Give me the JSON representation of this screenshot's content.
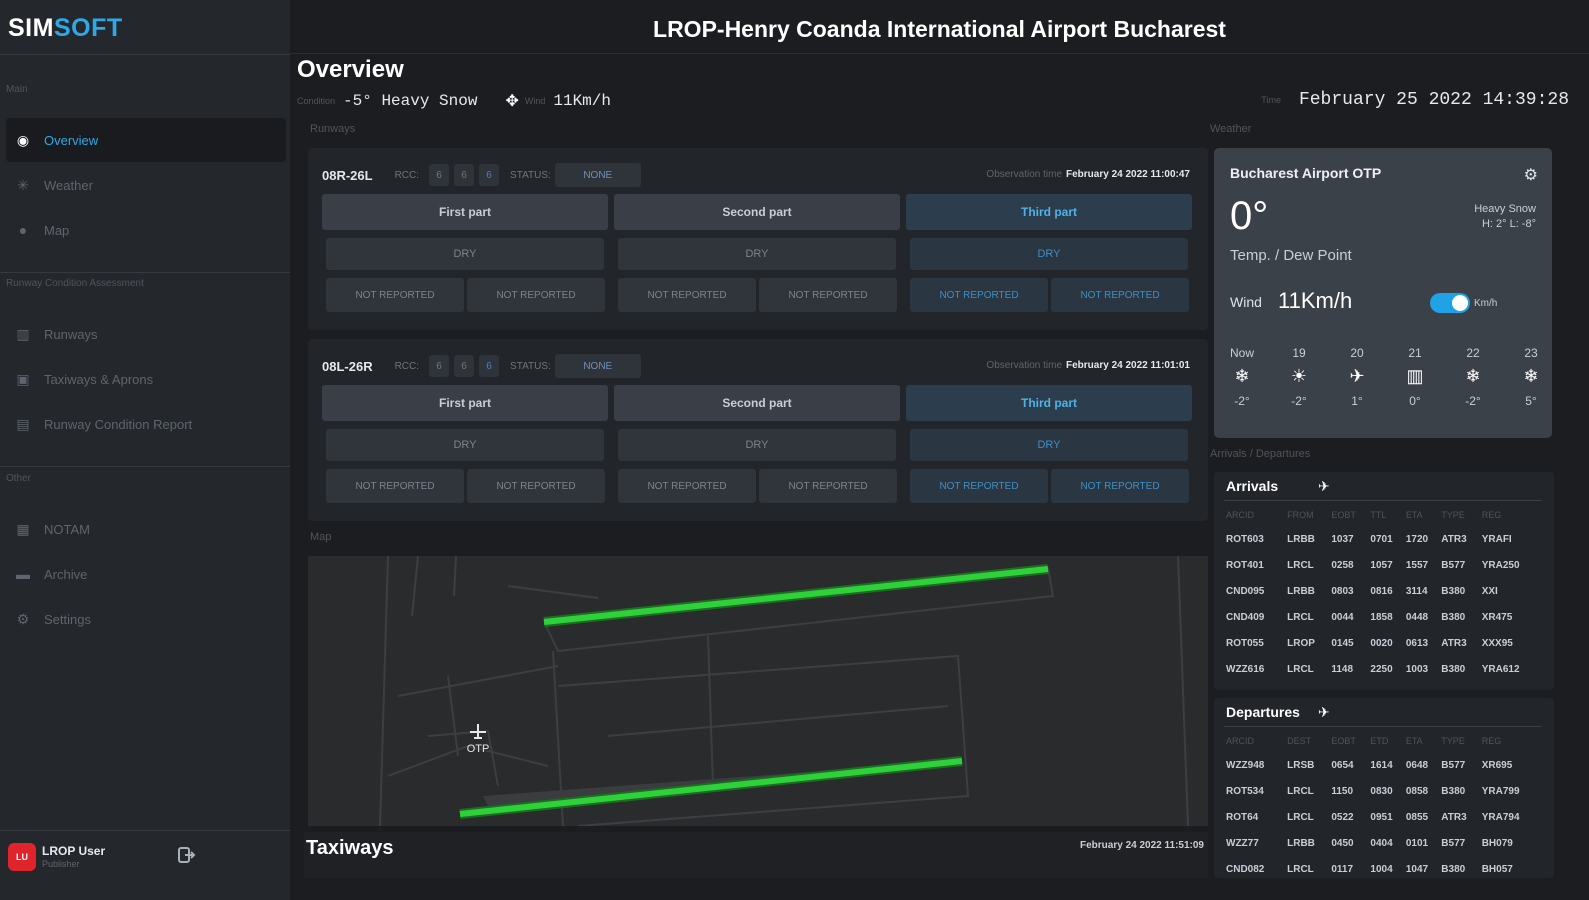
{
  "app": {
    "logo_sim": "SIM",
    "logo_soft": "SOFT",
    "header_title": "LROP-Henry Coanda International Airport Bucharest"
  },
  "sidebar": {
    "section_main": "Main",
    "section_rca": "Runway Condition Assessment",
    "section_other": "Other",
    "items": [
      {
        "label": "Overview",
        "icon": "dashboard-icon"
      },
      {
        "label": "Weather",
        "icon": "sun-icon"
      },
      {
        "label": "Map",
        "icon": "map-icon"
      },
      {
        "label": "Runways",
        "icon": "runway-icon"
      },
      {
        "label": "Taxiways & Aprons",
        "icon": "taxiway-icon"
      },
      {
        "label": "Runway Condition Report",
        "icon": "report-icon"
      },
      {
        "label": "NOTAM",
        "icon": "notam-icon"
      },
      {
        "label": "Archive",
        "icon": "archive-icon"
      },
      {
        "label": "Settings",
        "icon": "gear-icon"
      }
    ],
    "user": {
      "initials": "LU",
      "name": "LROP User",
      "role": "Publisher"
    }
  },
  "overview": {
    "title": "Overview",
    "condition_label": "Condition",
    "condition_value": "-5° Heavy Snow",
    "wind_label": "Wind",
    "wind_value": "11Km/h",
    "time_label": "Time",
    "time_value": "February 25 2022 14:39:28"
  },
  "sections": {
    "runways": "Runways",
    "weather": "Weather",
    "map": "Map",
    "arrivals_departures": "Arrivals / Departures"
  },
  "runways": [
    {
      "name": "08R-26L",
      "rcc_label": "RCC:",
      "rcc": [
        "6",
        "6",
        "6"
      ],
      "status_label": "STATUS:",
      "status": "NONE",
      "obs_label": "Observation time",
      "obs_time": "February 24 2022 11:00:47",
      "parts": [
        {
          "title": "First part",
          "condition": "DRY",
          "cells": [
            "NOT REPORTED",
            "NOT REPORTED"
          ]
        },
        {
          "title": "Second part",
          "condition": "DRY",
          "cells": [
            "NOT REPORTED",
            "NOT REPORTED"
          ]
        },
        {
          "title": "Third part",
          "condition": "DRY",
          "cells": [
            "NOT REPORTED",
            "NOT REPORTED"
          ]
        }
      ]
    },
    {
      "name": "08L-26R",
      "rcc_label": "RCC:",
      "rcc": [
        "6",
        "6",
        "6"
      ],
      "status_label": "STATUS:",
      "status": "NONE",
      "obs_label": "Observation time",
      "obs_time": "February 24 2022 11:01:01",
      "parts": [
        {
          "title": "First part",
          "condition": "DRY",
          "cells": [
            "NOT REPORTED",
            "NOT REPORTED"
          ]
        },
        {
          "title": "Second part",
          "condition": "DRY",
          "cells": [
            "NOT REPORTED",
            "NOT REPORTED"
          ]
        },
        {
          "title": "Third part",
          "condition": "DRY",
          "cells": [
            "NOT REPORTED",
            "NOT REPORTED"
          ]
        }
      ]
    }
  ],
  "map": {
    "airport_label": "OTP",
    "runway_color": "#2fd13a"
  },
  "taxiways": {
    "title": "Taxiways",
    "time": "February 24 2022 11:51:09"
  },
  "weather": {
    "station": "Bucharest Airport OTP",
    "temp": "0°",
    "cond_line1": "Heavy Snow",
    "cond_line2": "H: 2° L: -8°",
    "temp_dew": "Temp. / Dew Point",
    "wind_label": "Wind",
    "wind_value": "11Km/h",
    "wind_unit": "Km/h",
    "forecast": [
      {
        "hour": "Now",
        "icon": "snowflake-icon",
        "glyph": "❄",
        "temp": "-2°"
      },
      {
        "hour": "19",
        "icon": "sun-icon",
        "glyph": "☀",
        "temp": "-2°"
      },
      {
        "hour": "20",
        "icon": "plane-landing-icon",
        "glyph": "✈",
        "temp": "1°"
      },
      {
        "hour": "21",
        "icon": "runway-icon",
        "glyph": "▥",
        "temp": "0°"
      },
      {
        "hour": "22",
        "icon": "snowflake-icon",
        "glyph": "❄",
        "temp": "-2°"
      },
      {
        "hour": "23",
        "icon": "snowflake-icon",
        "glyph": "❄",
        "temp": "5°"
      }
    ]
  },
  "arrivals": {
    "title": "Arrivals",
    "columns": [
      "ARCID",
      "FROM",
      "EOBT",
      "TTL",
      "ETA",
      "TYPE",
      "REG"
    ],
    "rows": [
      [
        "ROT603",
        "LRBB",
        "1037",
        "0701",
        "1720",
        "ATR3",
        "YRAFI"
      ],
      [
        "ROT401",
        "LRCL",
        "0258",
        "1057",
        "1557",
        "B577",
        "YRA250"
      ],
      [
        "CND095",
        "LRBB",
        "0803",
        "0816",
        "3114",
        "B380",
        "XXI"
      ],
      [
        "CND409",
        "LRCL",
        "0044",
        "1858",
        "0448",
        "B380",
        "XR475"
      ],
      [
        "ROT055",
        "LROP",
        "0145",
        "0020",
        "0613",
        "ATR3",
        "XXX95"
      ],
      [
        "WZZ616",
        "LRCL",
        "1148",
        "2250",
        "1003",
        "B380",
        "YRA612"
      ]
    ]
  },
  "departures": {
    "title": "Departures",
    "columns": [
      "ARCID",
      "DEST",
      "EOBT",
      "ETD",
      "ETA",
      "TYPE",
      "REG"
    ],
    "rows": [
      [
        "WZZ948",
        "LRSB",
        "0654",
        "1614",
        "0648",
        "B577",
        "XR695"
      ],
      [
        "ROT534",
        "LRCL",
        "1150",
        "0830",
        "0858",
        "B380",
        "YRA799"
      ],
      [
        "ROT64",
        "LRCL",
        "0522",
        "0951",
        "0855",
        "ATR3",
        "YRA794"
      ],
      [
        "WZZ77",
        "LRBB",
        "0450",
        "0404",
        "0101",
        "B577",
        "BH079"
      ],
      [
        "CND082",
        "LRCL",
        "0117",
        "1004",
        "1047",
        "B380",
        "BH057"
      ]
    ]
  }
}
